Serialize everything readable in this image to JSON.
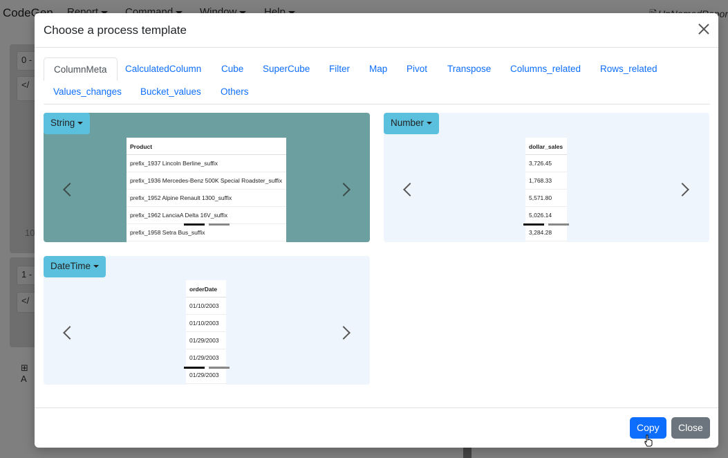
{
  "background": {
    "brand": "CodeGen",
    "menu": [
      "Report",
      "Command",
      "Window",
      "Help"
    ],
    "file_name": "UnNamedRepor",
    "panel1_label": "0 -",
    "panel2_label": "1 -",
    "code_icon": "</",
    "row_number": "10",
    "add_label": "A"
  },
  "modal": {
    "title": "Choose a process template",
    "tabs": [
      "ColumnMeta",
      "CalculatedColumn",
      "Cube",
      "SuperCube",
      "Filter",
      "Map",
      "Pivot",
      "Transpose",
      "Columns_related",
      "Rows_related",
      "Values_changes",
      "Bucket_values",
      "Others"
    ],
    "active_tab": "ColumnMeta"
  },
  "cards": {
    "string": {
      "dropdown": "String",
      "header": "Product",
      "rows": [
        "prefix_1937 Lincoln Berline_suffix",
        "prefix_1936 Mercedes-Benz 500K Special Roadster_suffix",
        "prefix_1952 Alpine Renault 1300_suffix",
        "prefix_1962 LanciaA Delta 16V_suffix",
        "prefix_1958 Setra Bus_suffix"
      ]
    },
    "number": {
      "dropdown": "Number",
      "header": "dollar_sales",
      "rows": [
        "3,726.45",
        "1,768.33",
        "5,571.80",
        "5,026.14",
        "3,284.28"
      ]
    },
    "datetime": {
      "dropdown": "DateTime",
      "header": "orderDate",
      "rows": [
        "01/10/2003",
        "01/10/2003",
        "01/29/2003",
        "01/29/2003",
        "01/29/2003"
      ]
    }
  },
  "footer": {
    "copy_label": "Copy",
    "close_label": "Close"
  },
  "colors": {
    "primary": "#0d6efd",
    "secondary": "#6c757d",
    "info": "#5bc0de",
    "teal_card": "#6c9f9f",
    "light_card": "#eef5fd"
  }
}
